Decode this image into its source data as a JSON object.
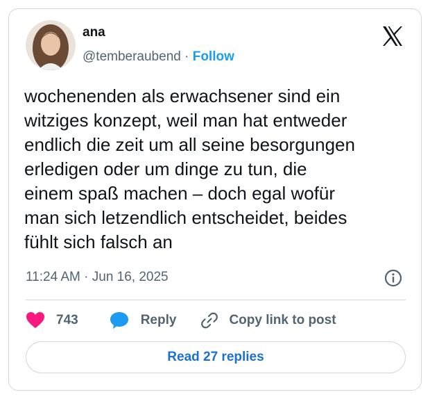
{
  "author": {
    "name": "ana",
    "handle": "@temberaubend",
    "separator": " · ",
    "follow_label": "Follow",
    "avatar_icon": "profile-photo"
  },
  "platform": {
    "logo_icon": "x-logo-icon"
  },
  "tweet": {
    "text": "wochenenden als erwachsener sind ein\nwitziges konzept, weil man hat entweder\nendlich die zeit um all seine besorgungen\nerledigen oder um dinge zu tun, die\neinem spaß machen – doch egal wofür\nman sich letzendlich entscheidet, beides\nfühlt sich falsch an",
    "timestamp": "11:24 AM · Jun 16, 2025",
    "info_icon": "info-icon"
  },
  "actions": {
    "like_count": "743",
    "like_icon": "heart-icon",
    "like_color": "#f91880",
    "reply_label": "Reply",
    "reply_icon": "speech-bubble-icon",
    "reply_color": "#1d9bf0",
    "copy_label": "Copy link to post",
    "copy_icon": "link-icon"
  },
  "footer": {
    "read_replies_label": "Read 27 replies"
  },
  "colors": {
    "accent": "#1d9bf0",
    "text": "#0f1419",
    "muted": "#536471",
    "border": "#cfd9de"
  }
}
